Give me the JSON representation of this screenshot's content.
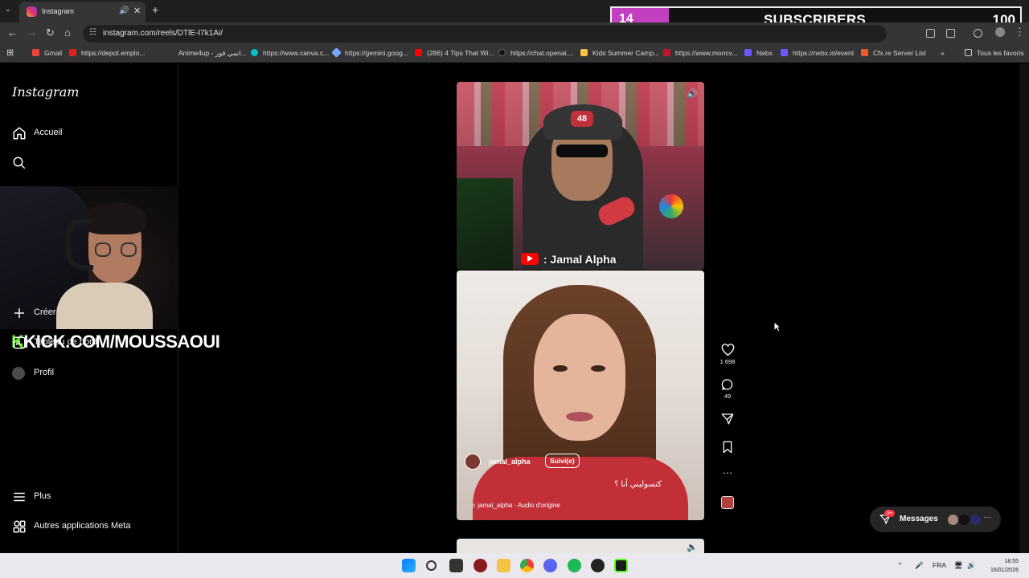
{
  "browser": {
    "tab_title": "Instagram",
    "url": "instagram.com/reels/DTlE-I7k1Ai/",
    "bookmarks": [
      {
        "label": "Gmail",
        "color": "#ea4335"
      },
      {
        "label": "https://depot.emplo...",
        "color": "#e02020"
      },
      {
        "label": "Anime4up - انمي فور...",
        "color": "#353535"
      },
      {
        "label": "https://www.canva.c...",
        "color": "#00c4cc"
      },
      {
        "label": "https://gemini.goog...",
        "color": "#7aa7ff"
      },
      {
        "label": "(286) 4 Tips That Wi...",
        "color": "#ff0000"
      },
      {
        "label": "https://chat.openai....",
        "color": "#222222"
      },
      {
        "label": "Kids Summer Camp...",
        "color": "#f6c342"
      },
      {
        "label": "https://www.moncv...",
        "color": "#c8102e"
      },
      {
        "label": "Nebx",
        "color": "#6b58ff"
      },
      {
        "label": "https://nebx.io/event",
        "color": "#6b58ff"
      },
      {
        "label": "Cfx.re Server List",
        "color": "#f05a28"
      }
    ],
    "all_bookmarks": "Tous les favoris"
  },
  "subscribers": {
    "current": "14",
    "label": "SUBSCRIBERS",
    "goal": "100",
    "progress": 0.14,
    "fill_color": "#c23fbf"
  },
  "sidebar": {
    "logo": "Instagram",
    "items": [
      {
        "label": "Accueil",
        "icon": "home-icon"
      },
      {
        "label": "",
        "icon": "search-icon"
      },
      {
        "label": "Créer",
        "icon": "plus-icon"
      },
      {
        "label": "Tableau de bord",
        "icon": "dashboard-icon"
      },
      {
        "label": "Profil",
        "icon": "avatar"
      },
      {
        "label": "Plus",
        "icon": "menu-icon"
      },
      {
        "label": "Autres applications Meta",
        "icon": "meta-apps-icon"
      }
    ]
  },
  "stream_overlay": {
    "kick_prefix": "K",
    "kick_text": "KICK.COM/MOUSSAOUI"
  },
  "reels": {
    "top_caption": ": Jamal Alpha",
    "current": {
      "username": "jamal_alpha",
      "follow_label": "Suivi(e)",
      "caption": "كتسوليني أنا ؟",
      "audio": "jamal_alpha · Audio d'origine",
      "likes": "1 698",
      "comments": "49"
    }
  },
  "messages": {
    "label": "Messages",
    "badge": "9+"
  },
  "taskbar": {
    "lang": "FRA",
    "time": "18:55",
    "date": "16/01/2026"
  }
}
